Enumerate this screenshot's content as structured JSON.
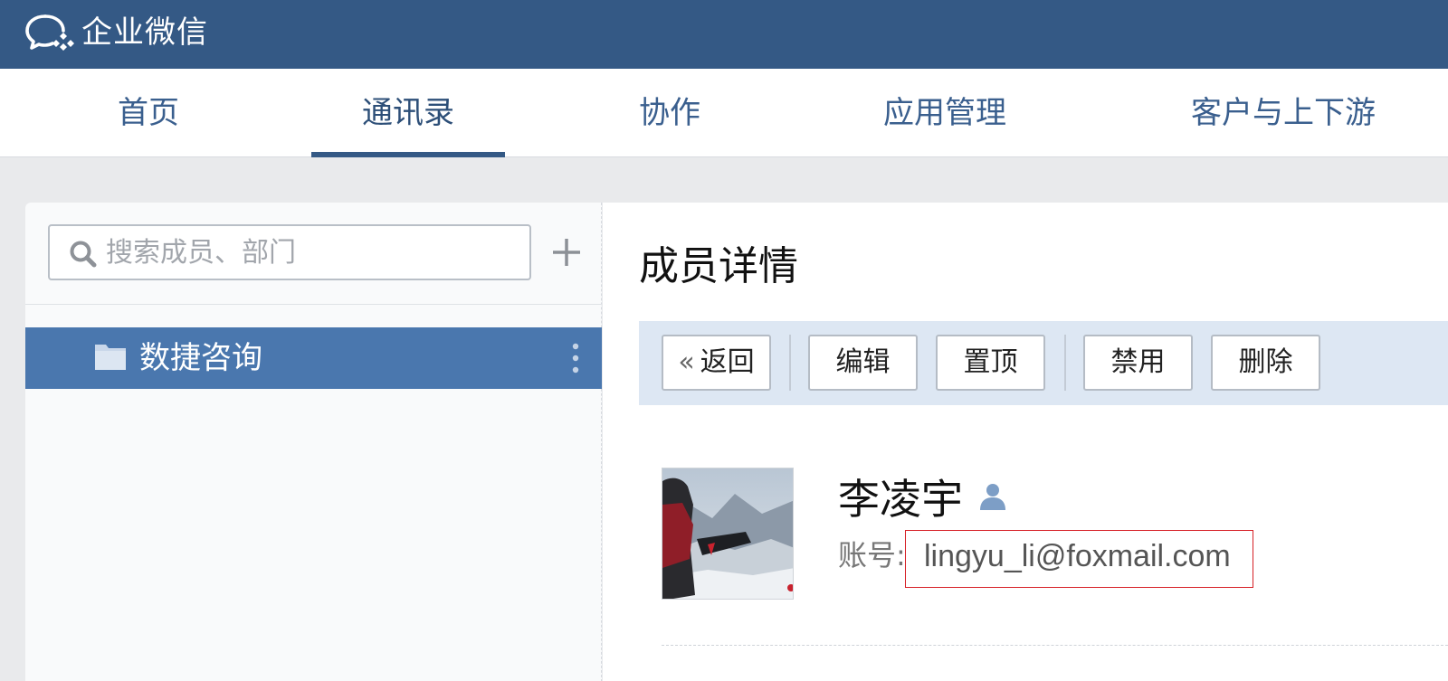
{
  "app": {
    "brand_name": "企业微信",
    "brand_color": "#345985",
    "logo_icon": "wecom-chat-bubble-icon"
  },
  "nav": {
    "tabs": [
      {
        "label": "首页",
        "active": false
      },
      {
        "label": "通讯录",
        "active": true
      },
      {
        "label": "协作",
        "active": false
      },
      {
        "label": "应用管理",
        "active": false
      },
      {
        "label": "客户与上下游",
        "active": false
      }
    ]
  },
  "sidebar": {
    "search_placeholder": "搜索成员、部门",
    "search_value": "",
    "add_icon": "plus-icon",
    "departments": [
      {
        "label": "数捷咨询",
        "selected": true,
        "icon": "folder-icon"
      }
    ],
    "selected_color": "#4a77ae"
  },
  "detail": {
    "title": "成员详情",
    "toolbar": {
      "back_label": "返回",
      "edit_label": "编辑",
      "pin_label": "置顶",
      "disable_label": "禁用",
      "delete_label": "删除"
    },
    "member": {
      "name": "李凌宇",
      "role_icon": "person-icon",
      "account_label": "账号:",
      "account_value": "lingyu_li@foxmail.com",
      "highlight_color": "#d61f26"
    }
  }
}
